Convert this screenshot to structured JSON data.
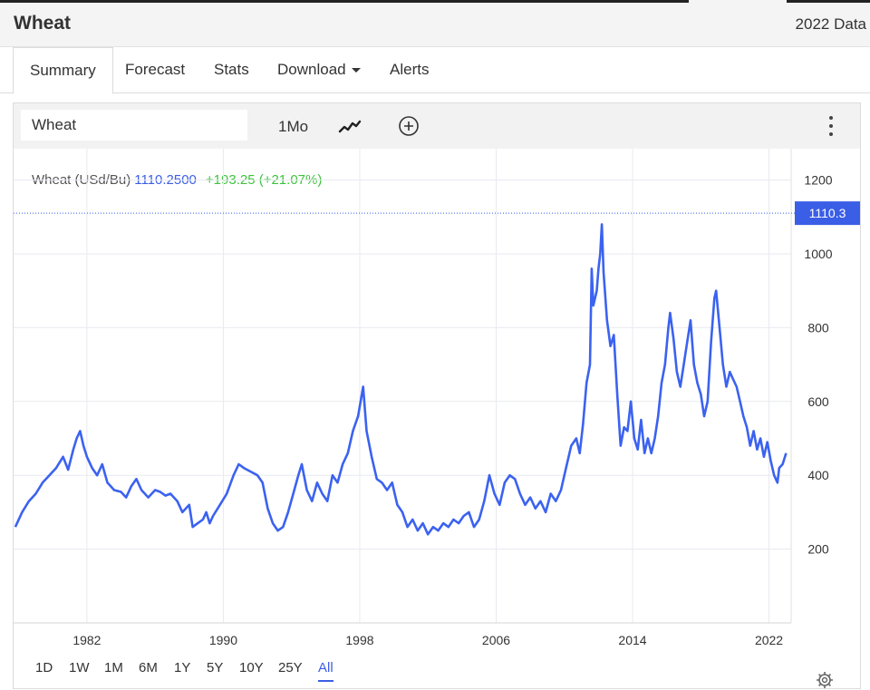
{
  "header": {
    "title": "Wheat",
    "right_text": "2022 Data"
  },
  "tabs": [
    {
      "label": "Summary"
    },
    {
      "label": "Forecast"
    },
    {
      "label": "Stats"
    },
    {
      "label": "Download"
    },
    {
      "label": "Alerts"
    }
  ],
  "toolbar": {
    "symbol_value": "Wheat",
    "interval_label": "1Mo",
    "icons": [
      "chart-type-icon",
      "compare-add-icon",
      "more-menu-icon"
    ]
  },
  "legend": {
    "name": "Wheat (USd/Bu)",
    "price": "1110.2500",
    "change": "+193.25 (+21.07%)"
  },
  "last_price_label": "1110.3",
  "ranges": [
    "1D",
    "1W",
    "1M",
    "6M",
    "1Y",
    "5Y",
    "10Y",
    "25Y",
    "All"
  ],
  "active_range": "All",
  "colors": {
    "line": "#3b62f0",
    "accent": "#3b5ee6",
    "up": "#3ec23e",
    "grid": "#e8eaf0"
  },
  "chart_data": {
    "type": "line",
    "x_ticks": [
      "1982",
      "1990",
      "1998",
      "2006",
      "2014",
      "2022"
    ],
    "y_ticks": [
      200,
      400,
      600,
      800,
      1000,
      1200
    ],
    "ylim": [
      0,
      1285
    ],
    "xlim": [
      1977.7,
      2023.3
    ],
    "grid": true,
    "last_value": 1110.3,
    "series": [
      {
        "name": "Wheat (USd/Bu)",
        "points": [
          [
            1977.8,
            260
          ],
          [
            1978.2,
            300
          ],
          [
            1978.6,
            330
          ],
          [
            1979.0,
            350
          ],
          [
            1979.4,
            380
          ],
          [
            1979.8,
            400
          ],
          [
            1980.2,
            420
          ],
          [
            1980.6,
            450
          ],
          [
            1980.9,
            415
          ],
          [
            1981.2,
            470
          ],
          [
            1981.4,
            500
          ],
          [
            1981.6,
            520
          ],
          [
            1981.8,
            480
          ],
          [
            1982.0,
            450
          ],
          [
            1982.3,
            420
          ],
          [
            1982.6,
            400
          ],
          [
            1982.9,
            430
          ],
          [
            1983.2,
            380
          ],
          [
            1983.6,
            360
          ],
          [
            1984.0,
            355
          ],
          [
            1984.3,
            340
          ],
          [
            1984.6,
            370
          ],
          [
            1984.9,
            390
          ],
          [
            1985.2,
            360
          ],
          [
            1985.6,
            340
          ],
          [
            1986.0,
            360
          ],
          [
            1986.3,
            355
          ],
          [
            1986.6,
            345
          ],
          [
            1986.9,
            350
          ],
          [
            1987.3,
            330
          ],
          [
            1987.6,
            300
          ],
          [
            1988.0,
            320
          ],
          [
            1988.2,
            260
          ],
          [
            1988.5,
            270
          ],
          [
            1988.8,
            280
          ],
          [
            1989.0,
            300
          ],
          [
            1989.2,
            270
          ],
          [
            1989.4,
            290
          ],
          [
            1989.8,
            320
          ],
          [
            1990.2,
            350
          ],
          [
            1990.6,
            400
          ],
          [
            1990.9,
            430
          ],
          [
            1991.2,
            420
          ],
          [
            1991.6,
            410
          ],
          [
            1992.0,
            400
          ],
          [
            1992.3,
            380
          ],
          [
            1992.6,
            310
          ],
          [
            1992.9,
            270
          ],
          [
            1993.2,
            250
          ],
          [
            1993.5,
            260
          ],
          [
            1993.8,
            300
          ],
          [
            1994.1,
            350
          ],
          [
            1994.4,
            400
          ],
          [
            1994.6,
            430
          ],
          [
            1994.9,
            360
          ],
          [
            1995.2,
            330
          ],
          [
            1995.5,
            380
          ],
          [
            1995.8,
            350
          ],
          [
            1996.1,
            330
          ],
          [
            1996.4,
            400
          ],
          [
            1996.7,
            380
          ],
          [
            1997.0,
            430
          ],
          [
            1997.3,
            460
          ],
          [
            1997.6,
            520
          ],
          [
            1997.9,
            560
          ],
          [
            1998.2,
            640
          ],
          [
            1998.4,
            520
          ],
          [
            1998.7,
            450
          ],
          [
            1999.0,
            390
          ],
          [
            1999.3,
            380
          ],
          [
            1999.6,
            360
          ],
          [
            1999.9,
            380
          ],
          [
            2000.2,
            320
          ],
          [
            2000.5,
            300
          ],
          [
            2000.8,
            260
          ],
          [
            2001.1,
            280
          ],
          [
            2001.4,
            250
          ],
          [
            2001.7,
            270
          ],
          [
            2002.0,
            240
          ],
          [
            2002.3,
            260
          ],
          [
            2002.6,
            250
          ],
          [
            2002.9,
            270
          ],
          [
            2003.2,
            260
          ],
          [
            2003.5,
            280
          ],
          [
            2003.8,
            270
          ],
          [
            2004.1,
            290
          ],
          [
            2004.4,
            300
          ],
          [
            2004.7,
            260
          ],
          [
            2005.0,
            280
          ],
          [
            2005.3,
            330
          ],
          [
            2005.6,
            400
          ],
          [
            2005.9,
            350
          ],
          [
            2006.2,
            320
          ],
          [
            2006.5,
            380
          ],
          [
            2006.8,
            400
          ],
          [
            2007.1,
            390
          ],
          [
            2007.4,
            350
          ],
          [
            2007.7,
            320
          ],
          [
            2008.0,
            340
          ],
          [
            2008.3,
            310
          ],
          [
            2008.6,
            330
          ],
          [
            2008.9,
            300
          ],
          [
            2009.2,
            350
          ],
          [
            2009.5,
            330
          ],
          [
            2009.8,
            360
          ],
          [
            2010.1,
            420
          ],
          [
            2010.4,
            480
          ],
          [
            2010.7,
            500
          ],
          [
            2010.9,
            460
          ],
          [
            2011.1,
            540
          ],
          [
            2011.3,
            650
          ],
          [
            2011.5,
            700
          ],
          [
            2011.6,
            960
          ],
          [
            2011.7,
            860
          ],
          [
            2011.9,
            900
          ],
          [
            2012.0,
            960
          ],
          [
            2012.1,
            1000
          ],
          [
            2012.2,
            1080
          ],
          [
            2012.3,
            950
          ],
          [
            2012.5,
            820
          ],
          [
            2012.7,
            750
          ],
          [
            2012.9,
            780
          ],
          [
            2013.1,
            620
          ],
          [
            2013.3,
            480
          ],
          [
            2013.5,
            530
          ],
          [
            2013.7,
            520
          ],
          [
            2013.9,
            600
          ],
          [
            2014.1,
            500
          ],
          [
            2014.3,
            470
          ],
          [
            2014.5,
            550
          ],
          [
            2014.7,
            460
          ],
          [
            2014.9,
            500
          ],
          [
            2015.1,
            460
          ],
          [
            2015.3,
            500
          ],
          [
            2015.5,
            560
          ],
          [
            2015.7,
            650
          ],
          [
            2015.9,
            700
          ],
          [
            2016.1,
            800
          ],
          [
            2016.2,
            840
          ],
          [
            2016.4,
            770
          ],
          [
            2016.6,
            680
          ],
          [
            2016.8,
            640
          ],
          [
            2017.0,
            700
          ],
          [
            2017.2,
            760
          ],
          [
            2017.4,
            820
          ],
          [
            2017.6,
            700
          ],
          [
            2017.8,
            650
          ],
          [
            2018.0,
            620
          ],
          [
            2018.2,
            560
          ],
          [
            2018.4,
            600
          ],
          [
            2018.6,
            760
          ],
          [
            2018.8,
            880
          ],
          [
            2018.9,
            900
          ],
          [
            2019.1,
            800
          ],
          [
            2019.3,
            700
          ],
          [
            2019.5,
            640
          ],
          [
            2019.7,
            680
          ],
          [
            2019.9,
            660
          ],
          [
            2020.1,
            640
          ],
          [
            2020.3,
            600
          ],
          [
            2020.5,
            560
          ],
          [
            2020.7,
            530
          ],
          [
            2020.9,
            480
          ],
          [
            2021.1,
            520
          ],
          [
            2021.3,
            470
          ],
          [
            2021.5,
            500
          ],
          [
            2021.7,
            450
          ],
          [
            2021.9,
            490
          ],
          [
            2022.1,
            440
          ],
          [
            2022.3,
            400
          ],
          [
            2022.5,
            380
          ],
          [
            2022.6,
            420
          ],
          [
            2022.8,
            430
          ],
          [
            2023.0,
            460
          ]
        ]
      }
    ]
  }
}
